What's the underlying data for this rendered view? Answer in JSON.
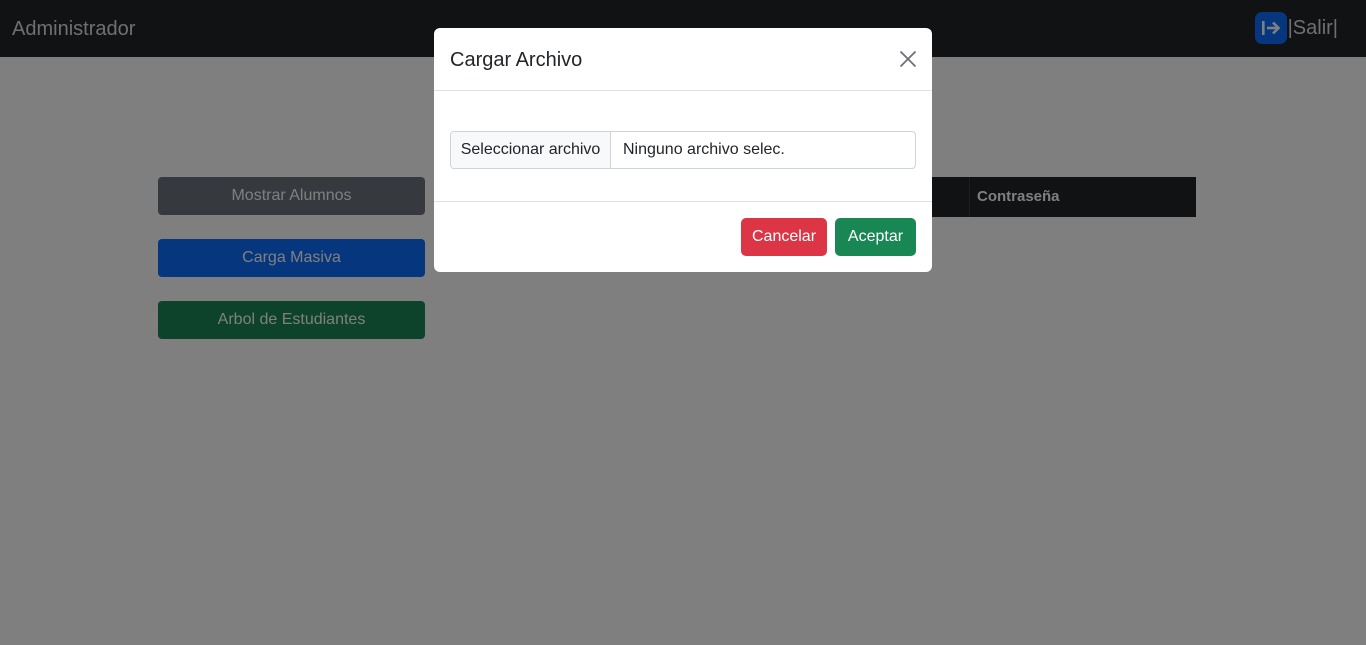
{
  "navbar": {
    "brand": "Administrador",
    "logout_label": "|Salir|",
    "logout_icon": "box-arrow-right-icon"
  },
  "sidebar": {
    "show_students": "Mostrar Alumnos",
    "bulk_upload": "Carga Masiva",
    "student_tree": "Arbol de Estudiantes"
  },
  "table": {
    "headers": [
      "Contraseña"
    ]
  },
  "modal": {
    "title": "Cargar Archivo",
    "file_button": "Seleccionar archivo",
    "file_name": "Ninguno archivo selec.",
    "cancel_label": "Cancelar",
    "accept_label": "Aceptar"
  },
  "colors": {
    "navbar": "#212529",
    "primary": "#0d6efd",
    "secondary": "#6c757d",
    "success": "#198754",
    "danger": "#dc3545"
  }
}
